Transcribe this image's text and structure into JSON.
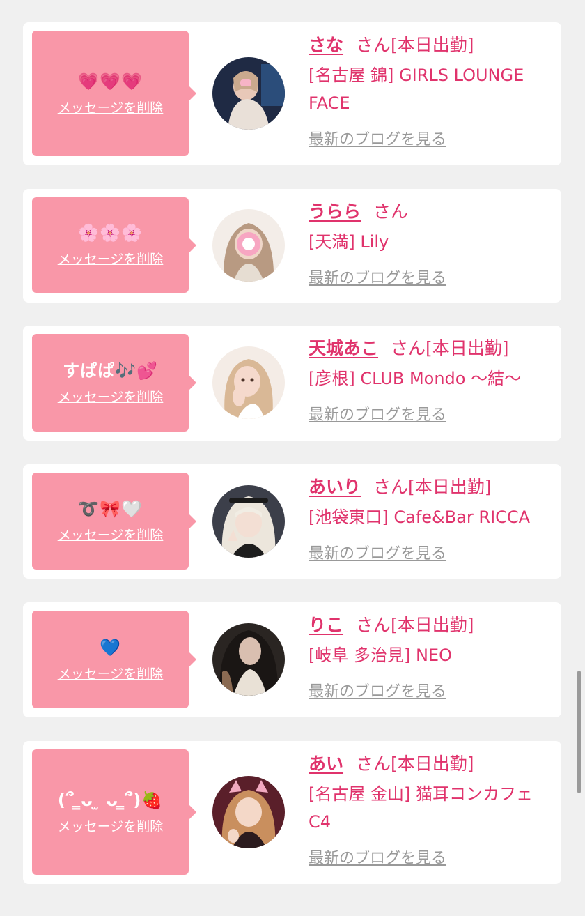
{
  "entries": [
    {
      "message": "💗💗💗",
      "delete_label": "メッセージを削除",
      "name": "さな",
      "honorific": "さん",
      "status": "[本日出勤]",
      "shop": "[名古屋 錦] GIRLS LOUNGE FACE",
      "blog_link": "最新のブログを見る"
    },
    {
      "message": "🌸🌸🌸",
      "delete_label": "メッセージを削除",
      "name": "うらら",
      "honorific": "さん",
      "status": "",
      "shop": "[天満] Lily",
      "blog_link": "最新のブログを見る"
    },
    {
      "message": "すぱぱ🎶💕",
      "delete_label": "メッセージを削除",
      "name": "天城あこ",
      "honorific": "さん",
      "status": "[本日出勤]",
      "shop": "[彦根] CLUB Mondo 〜結〜",
      "blog_link": "最新のブログを見る"
    },
    {
      "message": "➰🎀🤍",
      "delete_label": "メッセージを削除",
      "name": "あいり",
      "honorific": "さん",
      "status": "[本日出勤]",
      "shop": "[池袋東口] Cafe&Bar RICCA",
      "blog_link": "最新のブログを見る"
    },
    {
      "message": "💙",
      "delete_label": "メッセージを削除",
      "name": "りこ",
      "honorific": "さん",
      "status": "[本日出勤]",
      "shop": "[岐阜 多治見] NEO",
      "blog_link": "最新のブログを見る"
    },
    {
      "message": "(՞ ̳ᴗ ̫ ᴗ ̳՞)🍓",
      "delete_label": "メッセージを削除",
      "name": "あい",
      "honorific": "さん",
      "status": "[本日出勤]",
      "shop": "[名古屋 金山] 猫耳コンカフェ C4",
      "blog_link": "最新のブログを見る"
    }
  ],
  "colors": {
    "bubble": "#f997a8",
    "accent": "#e0336c",
    "link_gray": "#999999",
    "background": "#f0f0f0"
  }
}
